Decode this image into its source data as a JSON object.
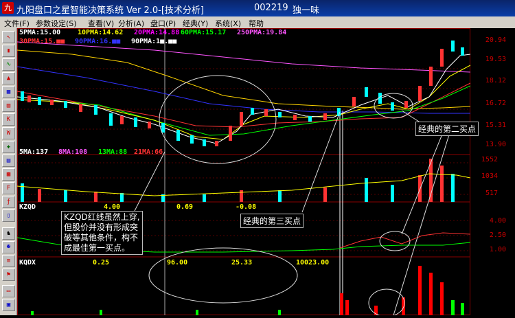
{
  "window": {
    "icon_text": "九",
    "title": "九阳盘口之星智能决策系统 Ver 2.0-[技术分析]",
    "stock_code": "002219",
    "stock_name": "独一味"
  },
  "menu": [
    "文件(F)",
    "参数设定(S)",
    "查看(V)",
    "分析(A)",
    "盘口(P)",
    "经典(Y)",
    "系统(X)",
    "帮助"
  ],
  "toolbar_icons": [
    "cursor-icon",
    "candle-icon",
    "line-icon",
    "indicator-icon",
    "chart-icon",
    "bar-icon",
    "k-icon",
    "w-icon",
    "tool-icon",
    "grid-icon",
    "stat-icon",
    "f10-icon",
    "f-icon",
    "doc-icon",
    "tick-icon",
    "people-icon",
    "list-icon",
    "flag-icon",
    "window-icon",
    "cfg-icon"
  ],
  "price_panel": {
    "ma_row1": [
      {
        "label": "5PMA:15.00",
        "color": "#ffffff"
      },
      {
        "label": "10PMA:14.62",
        "color": "#ffff00"
      },
      {
        "label": "20PMA:14.88",
        "color": "#ff00ff"
      },
      {
        "label": "60PMA:15.17",
        "color": "#00ff00"
      },
      {
        "label": "250PMA:19.84",
        "color": "#ff55ff"
      }
    ],
    "ma_row2": [
      {
        "label": "30PMA:15.■■",
        "color": "#ff3333"
      },
      {
        "label": "90PMA:16.■■",
        "color": "#3333ff"
      },
      {
        "label": "90PMA:1■.■■",
        "color": "#ffffff"
      }
    ],
    "axis": [
      "20.94",
      "19.53",
      "18.12",
      "16.72",
      "15.31",
      "13.90"
    ]
  },
  "volume_panel": {
    "labels": [
      {
        "label": "5MA:137",
        "color": "#ffffff"
      },
      {
        "label": "8MA:108",
        "color": "#ff55ff"
      },
      {
        "label": "13MA:88",
        "color": "#00ff00"
      },
      {
        "label": "21MA:66",
        "color": "#ff3333"
      }
    ],
    "axis": [
      "1552",
      "1034",
      "517"
    ]
  },
  "kzqd_panel": {
    "title": "KZQD",
    "values": [
      "4.00",
      "0.69",
      "-0.08"
    ],
    "axis": [
      "4.00",
      "2.50",
      "1.00"
    ]
  },
  "kqdx_panel": {
    "title": "KQDX",
    "values": [
      "0.25",
      "96.00",
      "25.33",
      "10023.00"
    ]
  },
  "annotations": {
    "second_buy": "经典的第二买点",
    "third_buy": "经典的第三买点",
    "kzqd_note": [
      "KZQD红线虽然上穿,",
      "但股价并没有形成突",
      "破等其他条件，构不",
      "成最佳第一买点。"
    ]
  }
}
